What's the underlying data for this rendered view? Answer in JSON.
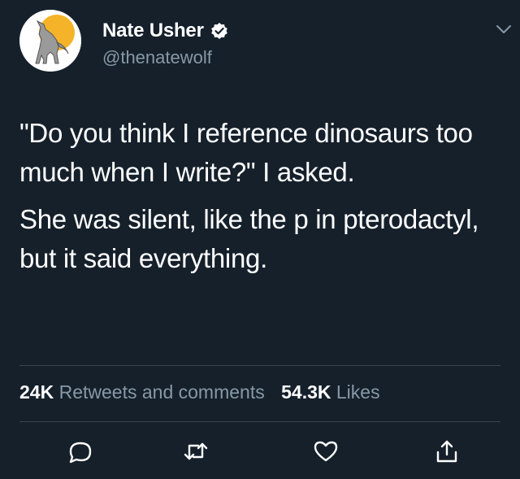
{
  "user": {
    "name": "Nate Usher",
    "handle": "@thenatewolf"
  },
  "tweet": {
    "paragraphs": [
      "\"Do you think I reference dinosaurs too much when I write?\" I asked.",
      "She was silent, like the p in pterodactyl, but it said everything."
    ]
  },
  "stats": {
    "retweets_count": "24K",
    "retweets_label": "Retweets and comments",
    "likes_count": "54.3K",
    "likes_label": "Likes"
  },
  "actions": [
    "comment-icon",
    "retweet-icon",
    "like-icon",
    "share-icon"
  ],
  "colors": {
    "background": "#15202b",
    "text": "#ffffff",
    "secondary": "#8899a6",
    "divider": "#38444d",
    "avatar_sun": "#f5b32a"
  }
}
